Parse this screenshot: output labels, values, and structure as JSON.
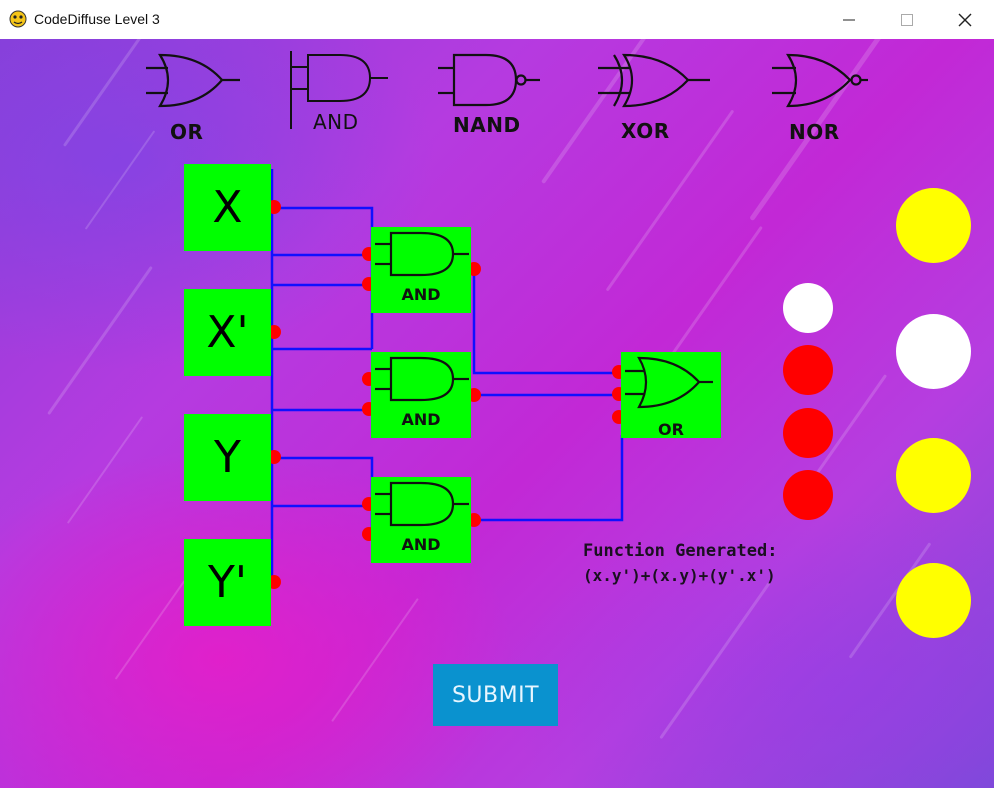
{
  "window": {
    "title": "CodeDiffuse Level 3",
    "minimize_glyph": "—",
    "maximize_glyph": "☐",
    "close_glyph": "✕"
  },
  "palette": {
    "labels": [
      "OR",
      "AND",
      "NAND",
      "XOR",
      "NOR"
    ]
  },
  "inputs": [
    "X",
    "X'",
    "Y",
    "Y'"
  ],
  "gates": [
    {
      "type": "AND"
    },
    {
      "type": "AND"
    },
    {
      "type": "AND"
    },
    {
      "type": "OR"
    }
  ],
  "function": {
    "title": "Function Generated:",
    "expression": "(x.y')+(x.y)+(y'.x')"
  },
  "submit_label": "SUBMIT",
  "colors": {
    "gate_fill": "#00ff00",
    "wire": "#1010ff",
    "pin": "#ff0000",
    "light_on": "#ffff00",
    "light_off": "#ffffff",
    "light_red": "#ff0000",
    "submit_bg": "#0a92cf"
  },
  "indicators": {
    "small": [
      "white",
      "red",
      "red",
      "red"
    ],
    "large": [
      "yellow",
      "white",
      "yellow",
      "yellow"
    ]
  }
}
